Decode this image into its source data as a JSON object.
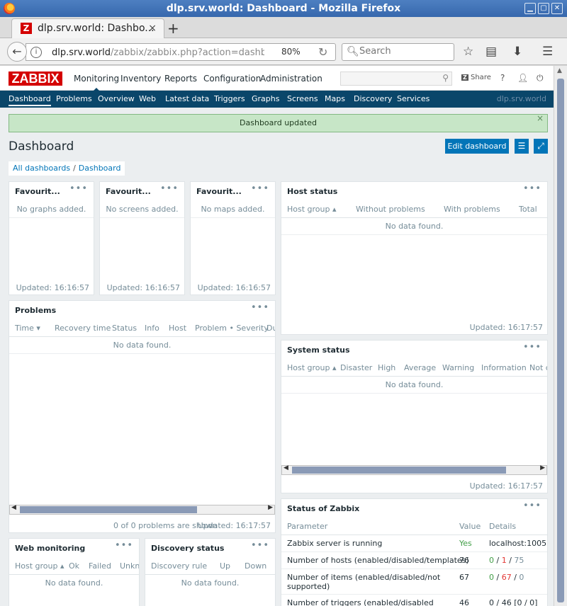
{
  "window": {
    "title": "dlp.srv.world: Dashboard - Mozilla Firefox"
  },
  "tab": {
    "title": "dlp.srv.world: Dashbo...",
    "close": "×",
    "new": "+"
  },
  "toolbar": {
    "url_host": "dlp.srv.world",
    "url_path": "/zabbix/zabbix.php?action=dashb",
    "zoom": "80%",
    "search_placeholder": "Search"
  },
  "zabbix": {
    "logo": "ZABBIX",
    "menu": [
      "Monitoring",
      "Inventory",
      "Reports",
      "Configuration",
      "Administration"
    ],
    "share": "Share",
    "help": "?",
    "submenu": [
      "Dashboard",
      "Problems",
      "Overview",
      "Web",
      "Latest data",
      "Triggers",
      "Graphs",
      "Screens",
      "Maps",
      "Discovery",
      "Services"
    ],
    "host": "dlp.srv.world"
  },
  "message": "Dashboard updated",
  "page": {
    "title": "Dashboard",
    "edit_button": "Edit dashboard",
    "breadcrumb": {
      "all": "All dashboards",
      "current": "Dashboard",
      "sep": "/"
    }
  },
  "widgets": {
    "fav_graphs": {
      "title": "Favourit...",
      "empty": "No graphs added.",
      "updated": "Updated: 16:16:57"
    },
    "fav_screens": {
      "title": "Favourit...",
      "empty": "No screens added.",
      "updated": "Updated: 16:16:57"
    },
    "fav_maps": {
      "title": "Favourit...",
      "empty": "No maps added.",
      "updated": "Updated: 16:16:57"
    },
    "problems": {
      "title": "Problems",
      "columns": [
        "Time ▾",
        "Recovery time",
        "Status",
        "Info",
        "Host",
        "Problem • Severity",
        "Du"
      ],
      "empty": "No data found.",
      "footer": "0 of 0 problems are shown",
      "updated": "Updated: 16:17:57"
    },
    "host_status": {
      "title": "Host status",
      "columns": [
        "Host group ▴",
        "Without problems",
        "With problems",
        "Total"
      ],
      "empty": "No data found.",
      "updated": "Updated: 16:17:57"
    },
    "system_status": {
      "title": "System status",
      "columns": [
        "Host group ▴",
        "Disaster",
        "High",
        "Average",
        "Warning",
        "Information",
        "Not cl"
      ],
      "empty": "No data found.",
      "updated": "Updated: 16:17:57"
    },
    "zabbix_status": {
      "title": "Status of Zabbix",
      "columns": [
        "Parameter",
        "Value",
        "Details"
      ],
      "rows": [
        {
          "param": "Zabbix server is running",
          "value": "Yes",
          "details": "localhost:10051"
        },
        {
          "param": "Number of hosts (enabled/disabled/templates)",
          "value": "76",
          "d1": "0",
          "d2": "1",
          "d3": "75"
        },
        {
          "param": "Number of items (enabled/disabled/not",
          "param2": "supported)",
          "value": "67",
          "d1": "0",
          "d2": "67",
          "d3": "0"
        },
        {
          "param": "Number of triggers (enabled/disabled",
          "value": "46",
          "details": "0 / 46 [0 / 0]"
        }
      ]
    },
    "web_monitoring": {
      "title": "Web monitoring",
      "columns": [
        "Host group ▴",
        "Ok",
        "Failed",
        "Unkno"
      ],
      "empty": "No data found."
    },
    "discovery_status": {
      "title": "Discovery status",
      "columns": [
        "Discovery rule",
        "Up",
        "Down"
      ],
      "empty": "No data found."
    }
  },
  "icons": {
    "dots": "•••",
    "close": "×"
  }
}
